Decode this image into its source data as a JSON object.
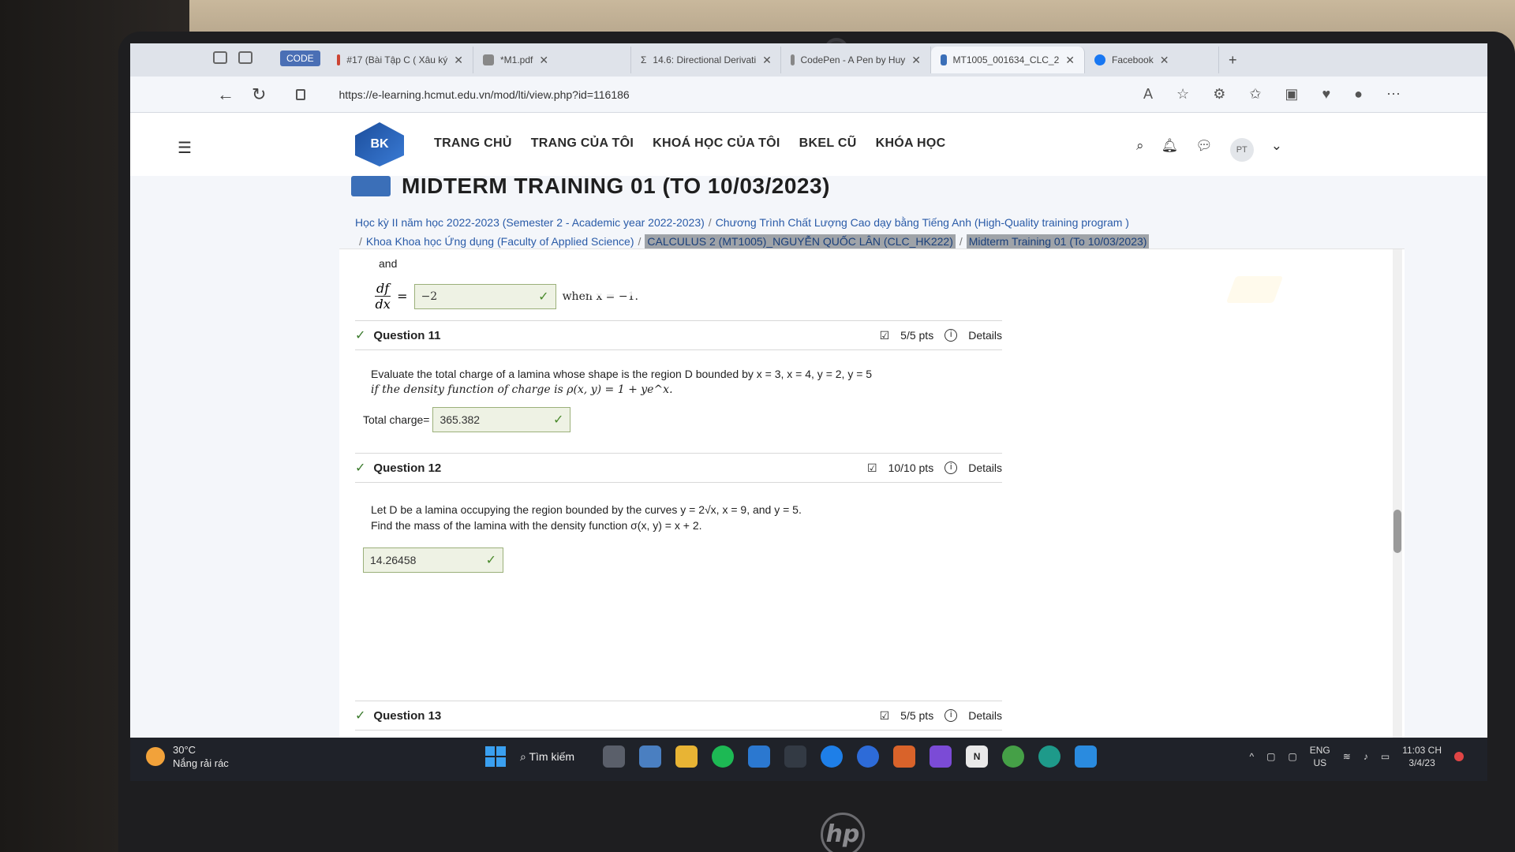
{
  "browser": {
    "code_badge": "CODE",
    "tabs": [
      {
        "label": "#17 (Bài Tập C ( Xâu ký"
      },
      {
        "label": "*M1.pdf"
      },
      {
        "label": "14.6: Directional Derivati"
      },
      {
        "label": "CodePen - A Pen by Huy"
      },
      {
        "label": "MT1005_001634_CLC_2"
      },
      {
        "label": "Facebook"
      }
    ],
    "url": "https://e-learning.hcmut.edu.vn/mod/lti/view.php?id=116186"
  },
  "site": {
    "logo_text": "BK",
    "menu": [
      "TRANG CHỦ",
      "TRANG CỦA TÔI",
      "KHOÁ HỌC CỦA TÔI",
      "BKEL CŨ",
      "KHÓA HỌC"
    ],
    "avatar": "PT"
  },
  "page": {
    "title": "MIDTERM TRAINING 01 (TO 10/03/2023)",
    "breadcrumb": [
      "Học kỳ II năm học 2022-2023 (Semester 2 - Academic year 2022-2023)",
      "Chương Trình Chất Lượng Cao dạy bằng Tiếng Anh (High-Quality training program )",
      "Khoa Khoa học Ứng dụng (Faculty of Applied Science)",
      "CALCULUS 2 (MT1005)_NGUYỄN QUỐC LÂN (CLC_HK222)",
      "Midterm Training 01 (To 10/03/2023)"
    ]
  },
  "prev_question": {
    "and": "and",
    "deriv_num": "df",
    "deriv_den": "dx",
    "answer": "−2",
    "when": "when x = −1."
  },
  "questions": [
    {
      "title": "Question 11",
      "points": "5/5 pts",
      "details": "Details",
      "text_line1": "Evaluate the total charge of a lamina whose shape is the region D bounded by x = 3, x = 4, y = 2, y = 5",
      "text_line2": "if the density function of charge is ρ(x, y) = 1 + ye^x.",
      "answer_label": "Total charge=",
      "answer": "365.382"
    },
    {
      "title": "Question 12",
      "points": "10/10 pts",
      "details": "Details",
      "text_line1": "Let D be a lamina occupying the region bounded by the curves y = 2√x, x = 9, and y = 5.",
      "text_line2": "Find the mass of the lamina with the density function σ(x, y) = x + 2.",
      "answer": "14.26458"
    },
    {
      "title": "Question 13",
      "points": "5/5 pts",
      "details": "Details"
    }
  ],
  "taskbar": {
    "temp": "30°C",
    "weather": "Nắng rải rác",
    "search": "Tìm kiếm",
    "lang_top": "ENG",
    "lang_bottom": "US",
    "time": "11:03 CH",
    "date": "3/4/23"
  }
}
